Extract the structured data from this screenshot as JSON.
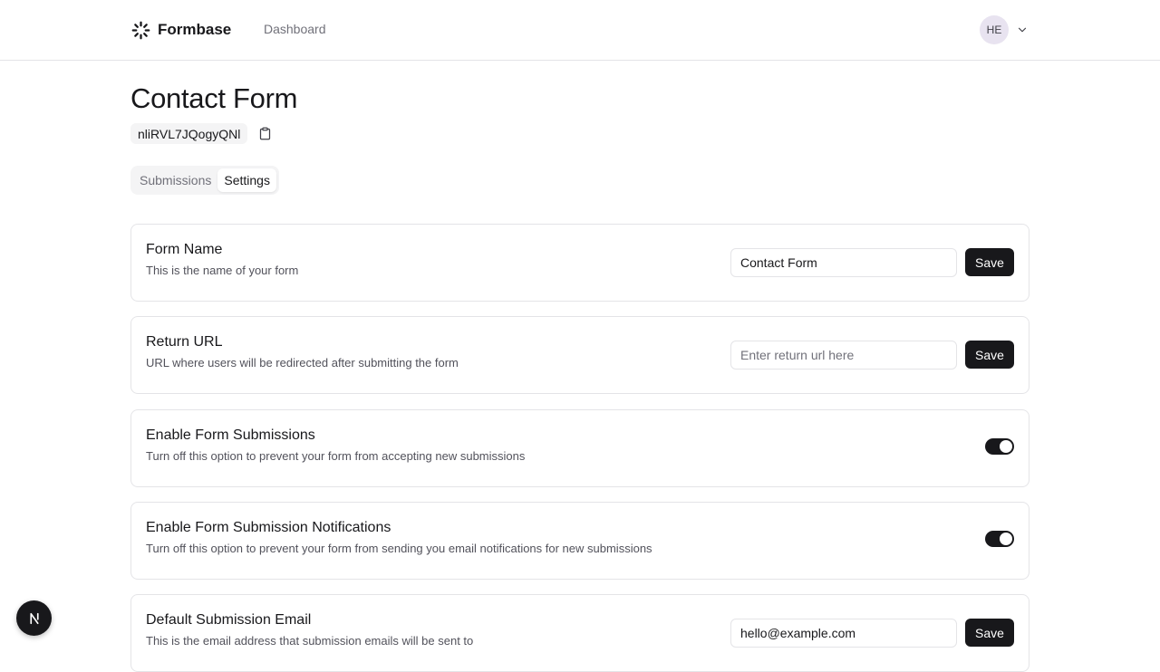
{
  "header": {
    "brand": "Formbase",
    "brand_icon": "spinner-logo-icon",
    "nav_dashboard": "Dashboard",
    "avatar_initials": "HE",
    "menu_icon": "chevron-down-icon"
  },
  "form": {
    "title": "Contact Form",
    "id": "nliRVL7JQogyQNl",
    "copy_icon": "clipboard-icon"
  },
  "tabs": [
    {
      "label": "Submissions",
      "active": false
    },
    {
      "label": "Settings",
      "active": true
    }
  ],
  "settings": {
    "form_name": {
      "title": "Form Name",
      "description": "This is the name of your form",
      "value": "Contact Form",
      "save_label": "Save"
    },
    "return_url": {
      "title": "Return URL",
      "description": "URL where users will be redirected after submitting the form",
      "value": "",
      "placeholder": "Enter return url here",
      "save_label": "Save"
    },
    "enable_submissions": {
      "title": "Enable Form Submissions",
      "description": "Turn off this option to prevent your form from accepting new submissions",
      "enabled": true
    },
    "enable_notifications": {
      "title": "Enable Form Submission Notifications",
      "description": "Turn off this option to prevent your form from sending you email notifications for new submissions",
      "enabled": true
    },
    "default_email": {
      "title": "Default Submission Email",
      "description": "This is the email address that submission emails will be sent to",
      "value": "hello@example.com",
      "save_label": "Save"
    }
  },
  "colors": {
    "primary": "#18181b",
    "muted_text": "#71717a",
    "border": "#e4e4e7",
    "tab_bg": "#f4f4f5"
  },
  "dev_badge_icon": "nextjs-icon"
}
